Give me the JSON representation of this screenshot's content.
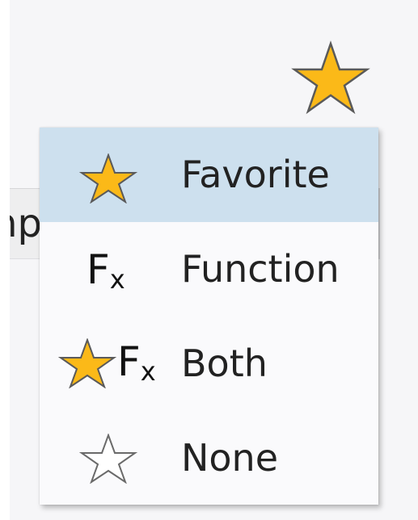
{
  "background": {
    "field_text_fragment": "np"
  },
  "header": {
    "filter_icon": "star-icon-filled"
  },
  "menu": {
    "selected_index": 0,
    "items": [
      {
        "label": "Favorite",
        "icon": "star-filled-icon"
      },
      {
        "label": "Function",
        "icon": "fx-icon"
      },
      {
        "label": "Both",
        "icon": "star-fx-icon"
      },
      {
        "label": "None",
        "icon": "star-outline-icon"
      }
    ],
    "fx_icon": {
      "big": "F",
      "small": "x"
    }
  },
  "colors": {
    "star_fill": "#fbb918",
    "star_stroke": "#5a5a5a",
    "selected_bg": "#cde0ee",
    "menu_bg": "#fafafc",
    "text": "#222222"
  }
}
